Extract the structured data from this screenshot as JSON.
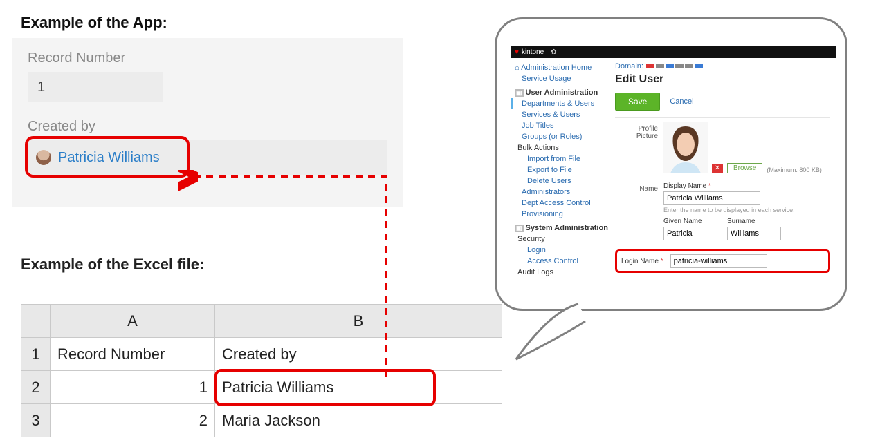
{
  "headings": {
    "app": "Example of the App:",
    "excel": "Example of the Excel file:"
  },
  "app_panel": {
    "record_number_label": "Record Number",
    "record_number_value": "1",
    "created_by_label": "Created by",
    "created_by_value": "Patricia Williams"
  },
  "excel": {
    "colA": "A",
    "colB": "B",
    "row1": "1",
    "row2": "2",
    "row3": "3",
    "header_record": "Record Number",
    "header_created": "Created by",
    "r2_num": "1",
    "r2_name": "Patricia Williams",
    "r3_num": "2",
    "r3_name": "Maria Jackson"
  },
  "admin": {
    "brand": "kintone",
    "nav": {
      "home": "Administration Home",
      "service_usage": "Service Usage",
      "user_admin": "User Administration",
      "dept_users": "Departments & Users",
      "services_users": "Services & Users",
      "job_titles": "Job Titles",
      "groups": "Groups (or Roles)",
      "bulk_actions": "Bulk Actions",
      "import": "Import from File",
      "export": "Export to File",
      "delete_users": "Delete Users",
      "administrators": "Administrators",
      "dept_access": "Dept Access Control",
      "provisioning": "Provisioning",
      "sys_admin": "System Administration",
      "security": "Security",
      "login": "Login",
      "access_control": "Access Control",
      "audit_logs": "Audit Logs"
    },
    "main": {
      "domain_label": "Domain:",
      "title": "Edit User",
      "save": "Save",
      "cancel": "Cancel",
      "profile_picture_label": "Profile Picture",
      "browse": "Browse",
      "max_kb": "(Maximum: 800 KB)",
      "name_label": "Name",
      "display_name_label": "Display Name",
      "display_name_value": "Patricia Williams",
      "display_name_hint": "Enter the name to be displayed in each service.",
      "given_name_label": "Given Name",
      "given_name_value": "Patricia",
      "surname_label": "Surname",
      "surname_value": "Williams",
      "login_name_label": "Login Name",
      "login_name_value": "patricia-williams",
      "required": "*"
    }
  }
}
